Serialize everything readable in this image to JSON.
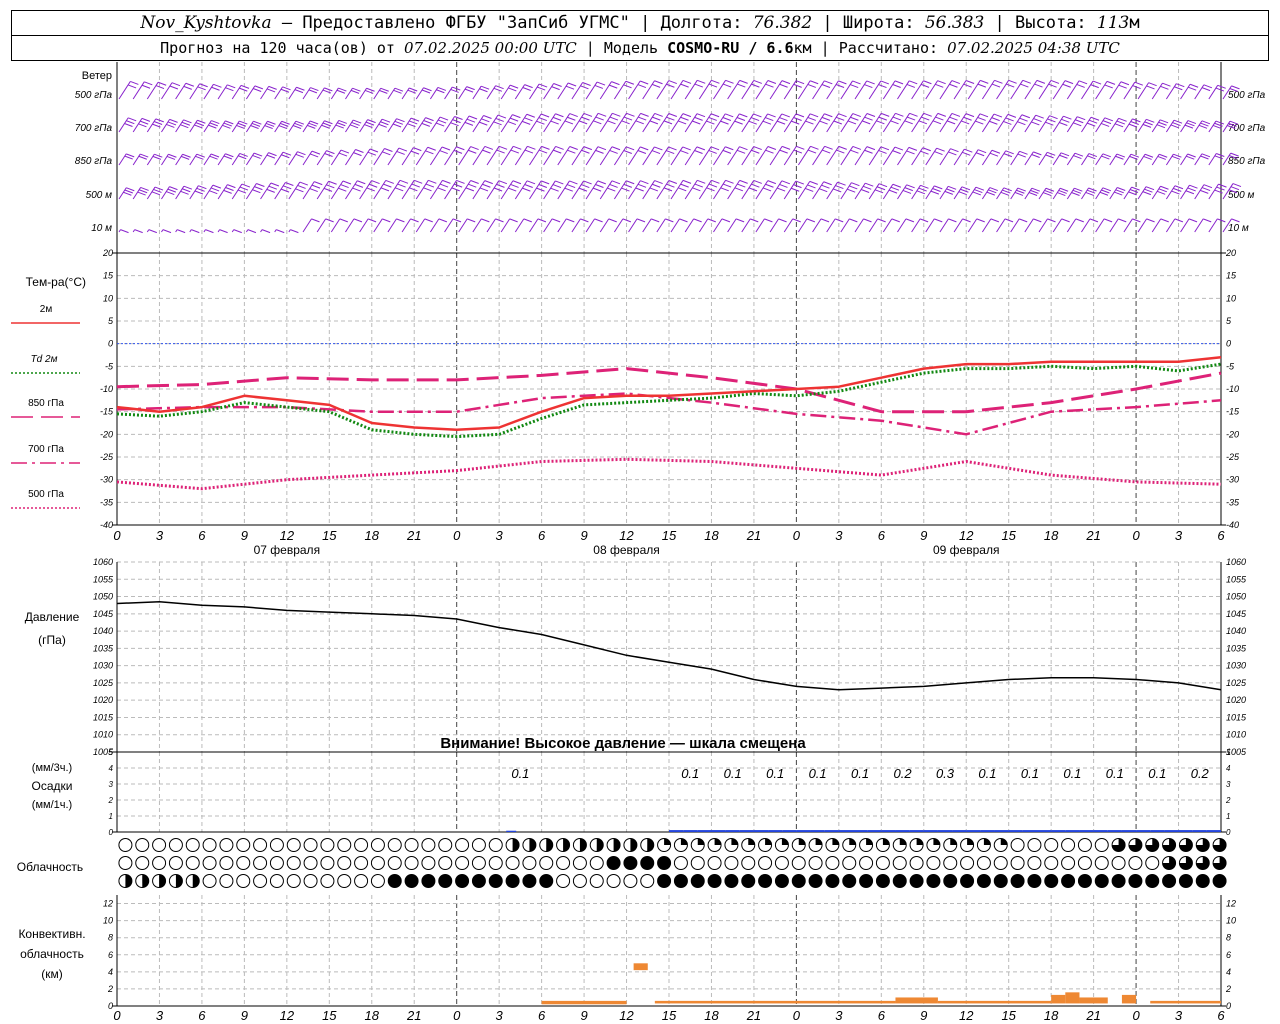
{
  "header": {
    "station": "Nov_Kyshtovka",
    "provider": "— Предоставлено ФГБУ \"ЗапСиб УГМС\"",
    "lon_label": "Долгота:",
    "lon_value": "76.382",
    "lat_label": "Широта:",
    "lat_value": "56.383",
    "alt_label": "Высота:",
    "alt_value": "113",
    "alt_unit": "м",
    "forecast_label": "Прогноз на 120 часа(ов) от",
    "forecast_time": "07.02.2025 00:00 UTC",
    "model_label": "Модель",
    "model_name": "COSMO-RU / 6.6",
    "model_unit": "км",
    "calc_label": "Рассчитано:",
    "calc_time": "07.02.2025 04:38 UTC"
  },
  "colors": {
    "t2m": "#ee3333",
    "td2m": "#118811",
    "t850": "#dd2277",
    "precip": "#2244dd",
    "conv": "#ee8833",
    "wind": "#8822cc"
  },
  "chart_data": [
    {
      "type": "wind_barbs",
      "title": "Ветер",
      "levels": [
        "500 гПа",
        "700 гПа",
        "850 гПа",
        "500 м",
        "10 м"
      ],
      "x_hours": [
        0,
        120
      ],
      "note": "Wind barbs at 5 levels every hour"
    },
    {
      "type": "line",
      "ylabel": "Тем-ра(°C)",
      "ylim": [
        -40,
        20
      ],
      "yticks": [
        20,
        15,
        10,
        5,
        0,
        -5,
        -10,
        -15,
        -20,
        -25,
        -30,
        -35,
        -40
      ],
      "legend": [
        {
          "name": "2м",
          "style": "solid",
          "color": "#ee3333"
        },
        {
          "name": "Td 2м",
          "style": "dotted",
          "color": "#118811"
        },
        {
          "name": "850 гПа",
          "style": "dash",
          "color": "#dd2277"
        },
        {
          "name": "700 гПа",
          "style": "dashdot",
          "color": "#dd2277"
        },
        {
          "name": "500 гПа",
          "style": "dense-dot",
          "color": "#dd2277"
        }
      ],
      "x_ticks": [
        "0",
        "3",
        "6",
        "9",
        "12",
        "15",
        "18",
        "21",
        "0",
        "3",
        "6",
        "9",
        "12",
        "15",
        "18",
        "21",
        "0",
        "3",
        "6",
        "9",
        "12",
        "15",
        "18",
        "21",
        "0",
        "3",
        "6"
      ],
      "day_labels": [
        "07 февраля",
        "08 февраля",
        "09 февраля"
      ],
      "series": [
        {
          "name": "2м",
          "x": [
            0,
            3,
            6,
            9,
            12,
            15,
            18,
            21,
            24,
            27,
            30,
            33,
            36,
            39,
            42,
            45,
            48,
            51,
            54,
            57,
            60,
            63,
            66,
            69,
            72,
            75,
            78
          ],
          "values": [
            -14,
            -15,
            -14,
            -11.5,
            -12.5,
            -13.5,
            -17.5,
            -18.5,
            -19,
            -18.5,
            -15,
            -12,
            -11.5,
            -11.5,
            -11,
            -10.5,
            -10,
            -9.5,
            -7.5,
            -5.5,
            -4.5,
            -4.5,
            -4,
            -4,
            -4,
            -4,
            -3
          ]
        },
        {
          "name": "Td 2м",
          "x": [
            0,
            3,
            6,
            9,
            12,
            15,
            18,
            21,
            24,
            27,
            30,
            33,
            36,
            39,
            42,
            45,
            48,
            51,
            54,
            57,
            60,
            63,
            66,
            69,
            72,
            75,
            78
          ],
          "values": [
            -15.5,
            -16,
            -15,
            -13,
            -14,
            -15,
            -19,
            -20,
            -20.5,
            -20,
            -16.5,
            -13.5,
            -13,
            -12.5,
            -12,
            -11,
            -11.5,
            -10.5,
            -8.5,
            -6.5,
            -5.5,
            -5.5,
            -5,
            -5.5,
            -5,
            -6,
            -4.5
          ]
        },
        {
          "name": "850 гПа",
          "x": [
            0,
            6,
            12,
            18,
            24,
            30,
            36,
            42,
            48,
            54,
            60,
            66,
            72,
            78
          ],
          "values": [
            -9.5,
            -9,
            -7.5,
            -8,
            -8,
            -7,
            -5.5,
            -7.5,
            -10,
            -15,
            -15,
            -13,
            -10,
            -6.5
          ]
        },
        {
          "name": "700 гПа",
          "x": [
            0,
            6,
            12,
            18,
            24,
            30,
            36,
            42,
            48,
            54,
            60,
            66,
            72,
            78
          ],
          "values": [
            -14.5,
            -14,
            -14,
            -15,
            -15,
            -12,
            -11,
            -13,
            -15.5,
            -17,
            -20,
            -15,
            -14,
            -12.5
          ]
        },
        {
          "name": "500 гПа",
          "x": [
            0,
            6,
            12,
            18,
            24,
            30,
            36,
            42,
            48,
            54,
            60,
            66,
            72,
            78
          ],
          "values": [
            -30.5,
            -32,
            -30,
            -29,
            -28,
            -26,
            -25.5,
            -26,
            -27.5,
            -29,
            -26,
            -29,
            -30.5,
            -31
          ]
        }
      ]
    },
    {
      "type": "line",
      "ylabel": "Давление",
      "yunit": "(гПа)",
      "ylim": [
        1005,
        1060
      ],
      "yticks": [
        1060,
        1055,
        1050,
        1045,
        1040,
        1035,
        1030,
        1025,
        1020,
        1015,
        1010,
        1005
      ],
      "annotation": "Внимание! Высокое давление — шкала смещена",
      "series": [
        {
          "name": "pressure",
          "x": [
            0,
            3,
            6,
            9,
            12,
            15,
            18,
            21,
            24,
            27,
            30,
            33,
            36,
            39,
            42,
            45,
            48,
            51,
            54,
            57,
            60,
            63,
            66,
            69,
            72,
            75,
            78
          ],
          "values": [
            1048,
            1048.5,
            1047.5,
            1047,
            1046,
            1045.5,
            1045,
            1044.5,
            1043.5,
            1041,
            1039,
            1036,
            1033,
            1031,
            1029,
            1026,
            1024,
            1023,
            1023.5,
            1024,
            1025,
            1026,
            1026.5,
            1026.5,
            1026,
            1025,
            1023
          ]
        }
      ]
    },
    {
      "type": "bar",
      "ylabel": "Осадки",
      "yunit_top": "(мм/3ч.)",
      "yunit_bottom": "(мм/1ч.)",
      "ylim": [
        0,
        5
      ],
      "yticks": [
        5,
        4,
        3,
        2,
        1,
        0
      ],
      "labels_3h": [
        {
          "x": 28.5,
          "value": "0.1"
        },
        {
          "x": 40.5,
          "value": "0.1"
        },
        {
          "x": 43.5,
          "value": "0.1"
        },
        {
          "x": 46.5,
          "value": "0.1"
        },
        {
          "x": 49.5,
          "value": "0.1"
        },
        {
          "x": 52.5,
          "value": "0.1"
        },
        {
          "x": 55.5,
          "value": "0.2"
        },
        {
          "x": 58.5,
          "value": "0.3"
        },
        {
          "x": 61.5,
          "value": "0.1"
        },
        {
          "x": 64.5,
          "value": "0.1"
        },
        {
          "x": 67.5,
          "value": "0.1"
        },
        {
          "x": 70.5,
          "value": "0.1"
        },
        {
          "x": 73.5,
          "value": "0.1"
        },
        {
          "x": 76.5,
          "value": "0.2"
        }
      ]
    },
    {
      "type": "cloud_symbols",
      "ylabel": "Облачность",
      "rows": 3,
      "symbols_per_row": 66
    },
    {
      "type": "bar",
      "ylabel": "Конвективн. облачность",
      "yunit": "(км)",
      "ylim": [
        0,
        13
      ],
      "yticks": [
        12,
        10,
        8,
        6,
        4,
        2,
        0
      ],
      "x_ticks": [
        "0",
        "3",
        "6",
        "9",
        "12",
        "15",
        "18",
        "21",
        "0",
        "3",
        "6",
        "9",
        "12",
        "15",
        "18",
        "21",
        "0",
        "3",
        "6",
        "9",
        "12",
        "15",
        "18",
        "21",
        "0",
        "3",
        "6"
      ],
      "segments": [
        {
          "x0": 30,
          "x1": 36,
          "bottom": 0.2,
          "top": 0.6
        },
        {
          "x0": 36.5,
          "x1": 37.5,
          "bottom": 4.2,
          "top": 5.0
        },
        {
          "x0": 38,
          "x1": 55,
          "bottom": 0.3,
          "top": 0.6
        },
        {
          "x0": 55,
          "x1": 58,
          "bottom": 0.3,
          "top": 1.0
        },
        {
          "x0": 58,
          "x1": 66,
          "bottom": 0.3,
          "top": 0.6
        },
        {
          "x0": 66,
          "x1": 67,
          "bottom": 0.3,
          "top": 1.3
        },
        {
          "x0": 67,
          "x1": 68,
          "bottom": 0.3,
          "top": 1.6
        },
        {
          "x0": 68,
          "x1": 70,
          "bottom": 0.3,
          "top": 1.0
        },
        {
          "x0": 71,
          "x1": 72,
          "bottom": 0.3,
          "top": 1.3
        },
        {
          "x0": 73,
          "x1": 78,
          "bottom": 0.3,
          "top": 0.6
        }
      ]
    }
  ]
}
